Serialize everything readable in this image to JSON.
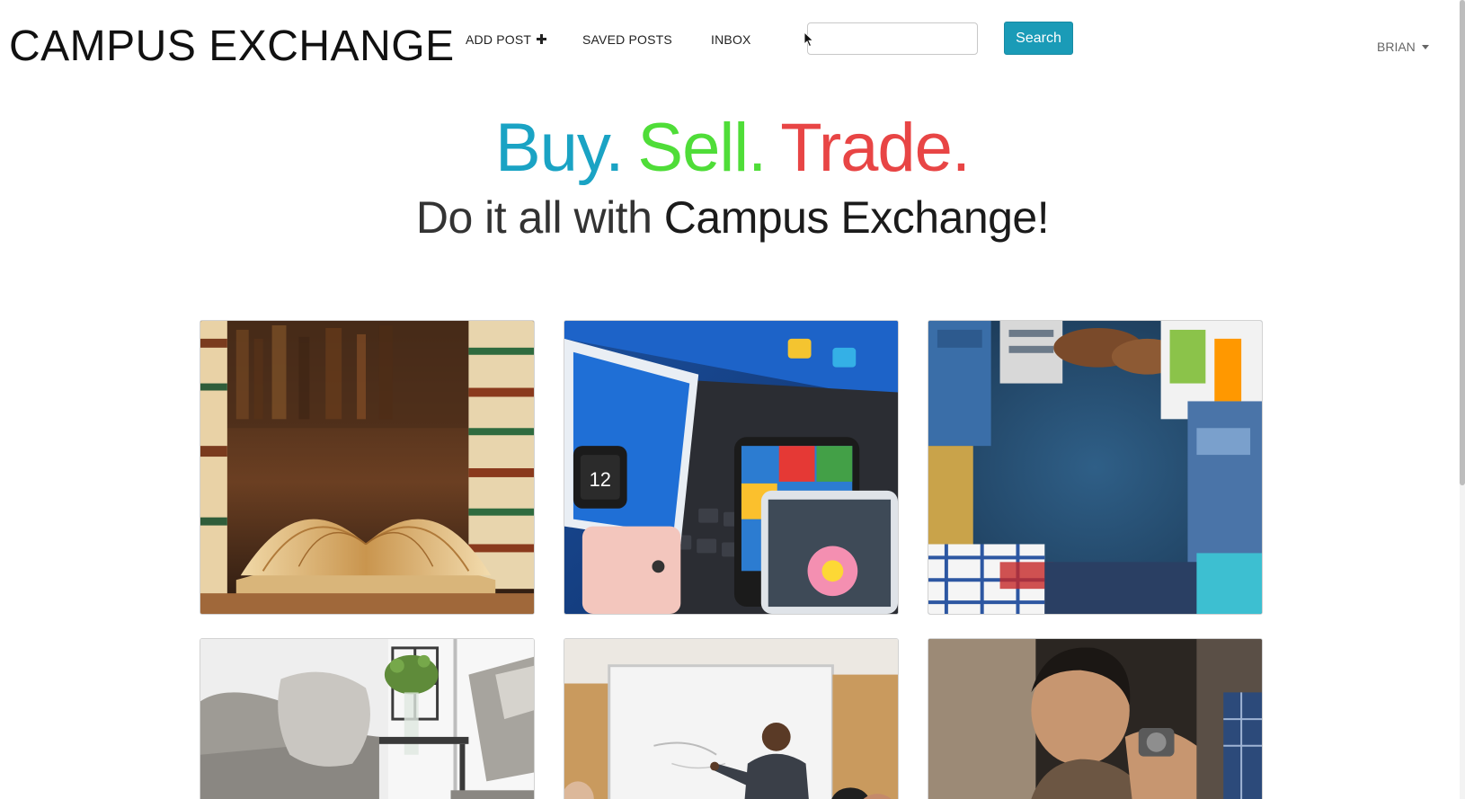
{
  "navbar": {
    "brand": "CAMPUS EXCHANGE",
    "links": {
      "add_post": "ADD POST",
      "saved_posts": "SAVED POSTS",
      "inbox": "INBOX"
    },
    "search": {
      "value": "",
      "placeholder": "",
      "button_label": "Search"
    },
    "user": {
      "name": "BRIAN"
    }
  },
  "hero": {
    "word_buy": "Buy.",
    "word_sell": "Sell.",
    "word_trade": "Trade.",
    "sub_prefix": "Do it all with",
    "sub_brand": "Campus Exchange!"
  },
  "colors": {
    "buy": "#1aa3c4",
    "sell": "#4fdd38",
    "trade": "#e84545",
    "search_button": "#1a9bb7"
  },
  "categories": [
    {
      "icon": "books-photo"
    },
    {
      "icon": "electronics-photo"
    },
    {
      "icon": "clothing-photo"
    },
    {
      "icon": "furniture-photo"
    },
    {
      "icon": "tutoring-photo"
    },
    {
      "icon": "services-photo"
    }
  ]
}
